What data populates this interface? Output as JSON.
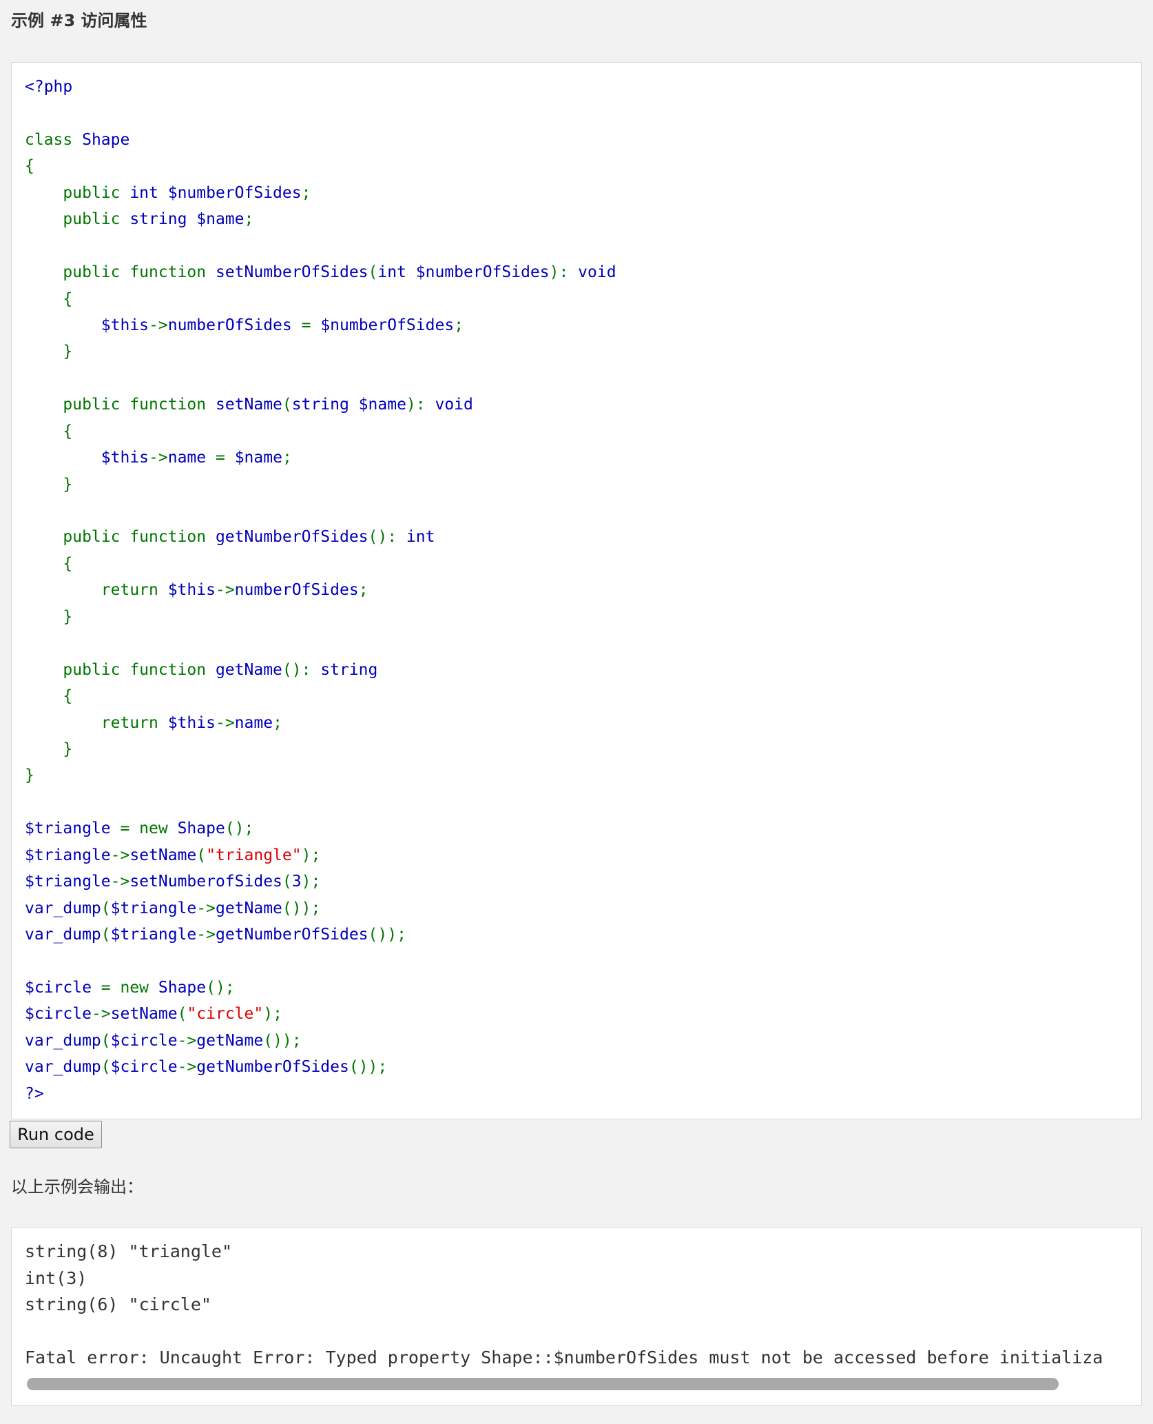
{
  "example": {
    "title": "示例 #3 访问属性"
  },
  "code": {
    "lines": [
      [
        {
          "t": "<?php",
          "c": "d"
        }
      ],
      [],
      [
        {
          "t": "class ",
          "c": "k"
        },
        {
          "t": "Shape",
          "c": "d"
        }
      ],
      [
        {
          "t": "{",
          "c": "k"
        }
      ],
      [
        {
          "t": "    public ",
          "c": "k"
        },
        {
          "t": "int $numberOfSides",
          "c": "d"
        },
        {
          "t": ";",
          "c": "k"
        }
      ],
      [
        {
          "t": "    public ",
          "c": "k"
        },
        {
          "t": "string $name",
          "c": "d"
        },
        {
          "t": ";",
          "c": "k"
        }
      ],
      [],
      [
        {
          "t": "    public function ",
          "c": "k"
        },
        {
          "t": "setNumberOfSides",
          "c": "d"
        },
        {
          "t": "(",
          "c": "k"
        },
        {
          "t": "int $numberOfSides",
          "c": "d"
        },
        {
          "t": "): ",
          "c": "k"
        },
        {
          "t": "void",
          "c": "d"
        }
      ],
      [
        {
          "t": "    {",
          "c": "k"
        }
      ],
      [
        {
          "t": "        ",
          "c": "k"
        },
        {
          "t": "$this",
          "c": "d"
        },
        {
          "t": "->",
          "c": "k"
        },
        {
          "t": "numberOfSides ",
          "c": "d"
        },
        {
          "t": "= ",
          "c": "k"
        },
        {
          "t": "$numberOfSides",
          "c": "d"
        },
        {
          "t": ";",
          "c": "k"
        }
      ],
      [
        {
          "t": "    }",
          "c": "k"
        }
      ],
      [],
      [
        {
          "t": "    public function ",
          "c": "k"
        },
        {
          "t": "setName",
          "c": "d"
        },
        {
          "t": "(",
          "c": "k"
        },
        {
          "t": "string $name",
          "c": "d"
        },
        {
          "t": "): ",
          "c": "k"
        },
        {
          "t": "void",
          "c": "d"
        }
      ],
      [
        {
          "t": "    {",
          "c": "k"
        }
      ],
      [
        {
          "t": "        ",
          "c": "k"
        },
        {
          "t": "$this",
          "c": "d"
        },
        {
          "t": "->",
          "c": "k"
        },
        {
          "t": "name ",
          "c": "d"
        },
        {
          "t": "= ",
          "c": "k"
        },
        {
          "t": "$name",
          "c": "d"
        },
        {
          "t": ";",
          "c": "k"
        }
      ],
      [
        {
          "t": "    }",
          "c": "k"
        }
      ],
      [],
      [
        {
          "t": "    public function ",
          "c": "k"
        },
        {
          "t": "getNumberOfSides",
          "c": "d"
        },
        {
          "t": "(): ",
          "c": "k"
        },
        {
          "t": "int",
          "c": "d"
        }
      ],
      [
        {
          "t": "    {",
          "c": "k"
        }
      ],
      [
        {
          "t": "        return ",
          "c": "k"
        },
        {
          "t": "$this",
          "c": "d"
        },
        {
          "t": "->",
          "c": "k"
        },
        {
          "t": "numberOfSides",
          "c": "d"
        },
        {
          "t": ";",
          "c": "k"
        }
      ],
      [
        {
          "t": "    }",
          "c": "k"
        }
      ],
      [],
      [
        {
          "t": "    public function ",
          "c": "k"
        },
        {
          "t": "getName",
          "c": "d"
        },
        {
          "t": "(): ",
          "c": "k"
        },
        {
          "t": "string",
          "c": "d"
        }
      ],
      [
        {
          "t": "    {",
          "c": "k"
        }
      ],
      [
        {
          "t": "        return ",
          "c": "k"
        },
        {
          "t": "$this",
          "c": "d"
        },
        {
          "t": "->",
          "c": "k"
        },
        {
          "t": "name",
          "c": "d"
        },
        {
          "t": ";",
          "c": "k"
        }
      ],
      [
        {
          "t": "    }",
          "c": "k"
        }
      ],
      [
        {
          "t": "}",
          "c": "k"
        }
      ],
      [],
      [
        {
          "t": "$triangle ",
          "c": "d"
        },
        {
          "t": "= new ",
          "c": "k"
        },
        {
          "t": "Shape",
          "c": "d"
        },
        {
          "t": "();",
          "c": "k"
        }
      ],
      [
        {
          "t": "$triangle",
          "c": "d"
        },
        {
          "t": "->",
          "c": "k"
        },
        {
          "t": "setName",
          "c": "d"
        },
        {
          "t": "(",
          "c": "k"
        },
        {
          "t": "\"triangle\"",
          "c": "s"
        },
        {
          "t": ");",
          "c": "k"
        }
      ],
      [
        {
          "t": "$triangle",
          "c": "d"
        },
        {
          "t": "->",
          "c": "k"
        },
        {
          "t": "setNumberofSides",
          "c": "d"
        },
        {
          "t": "(",
          "c": "k"
        },
        {
          "t": "3",
          "c": "d"
        },
        {
          "t": ");",
          "c": "k"
        }
      ],
      [
        {
          "t": "var_dump",
          "c": "d"
        },
        {
          "t": "(",
          "c": "k"
        },
        {
          "t": "$triangle",
          "c": "d"
        },
        {
          "t": "->",
          "c": "k"
        },
        {
          "t": "getName",
          "c": "d"
        },
        {
          "t": "());",
          "c": "k"
        }
      ],
      [
        {
          "t": "var_dump",
          "c": "d"
        },
        {
          "t": "(",
          "c": "k"
        },
        {
          "t": "$triangle",
          "c": "d"
        },
        {
          "t": "->",
          "c": "k"
        },
        {
          "t": "getNumberOfSides",
          "c": "d"
        },
        {
          "t": "());",
          "c": "k"
        }
      ],
      [],
      [
        {
          "t": "$circle ",
          "c": "d"
        },
        {
          "t": "= new ",
          "c": "k"
        },
        {
          "t": "Shape",
          "c": "d"
        },
        {
          "t": "();",
          "c": "k"
        }
      ],
      [
        {
          "t": "$circle",
          "c": "d"
        },
        {
          "t": "->",
          "c": "k"
        },
        {
          "t": "setName",
          "c": "d"
        },
        {
          "t": "(",
          "c": "k"
        },
        {
          "t": "\"circle\"",
          "c": "s"
        },
        {
          "t": ");",
          "c": "k"
        }
      ],
      [
        {
          "t": "var_dump",
          "c": "d"
        },
        {
          "t": "(",
          "c": "k"
        },
        {
          "t": "$circle",
          "c": "d"
        },
        {
          "t": "->",
          "c": "k"
        },
        {
          "t": "getName",
          "c": "d"
        },
        {
          "t": "());",
          "c": "k"
        }
      ],
      [
        {
          "t": "var_dump",
          "c": "d"
        },
        {
          "t": "(",
          "c": "k"
        },
        {
          "t": "$circle",
          "c": "d"
        },
        {
          "t": "->",
          "c": "k"
        },
        {
          "t": "getNumberOfSides",
          "c": "d"
        },
        {
          "t": "());",
          "c": "k"
        }
      ],
      [
        {
          "t": "?>",
          "c": "d"
        }
      ]
    ]
  },
  "run_button": {
    "label": "Run code"
  },
  "output": {
    "intro": "以上示例会输出：",
    "lines": [
      "string(8) \"triangle\"",
      "int(3)",
      "string(6) \"circle\"",
      "",
      "Fatal error: Uncaught Error: Typed property Shape::$numberOfSides must not be accessed before initializa"
    ]
  },
  "colors": {
    "page_background": "#f2f2f2",
    "panel_background": "#ffffff",
    "panel_border": "#d8d8d8",
    "keyword": "#007700",
    "default": "#0000bb",
    "string": "#dd0000",
    "output_text": "#333333",
    "scrollbar_thumb": "#a9a9a9"
  },
  "scrollbar": {
    "visible_fraction": 0.96
  }
}
